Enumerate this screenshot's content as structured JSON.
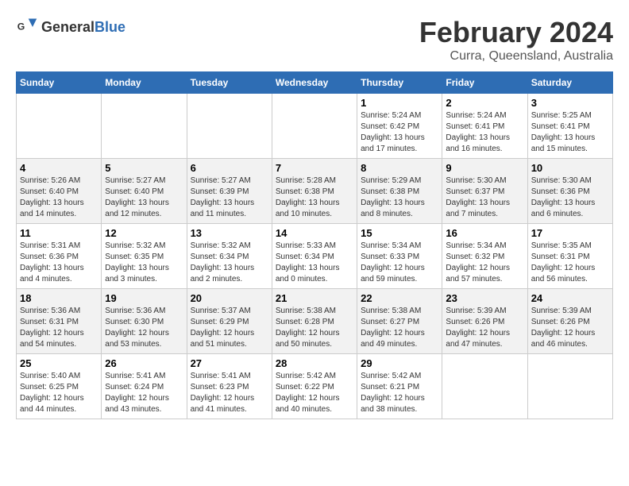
{
  "header": {
    "logo_general": "General",
    "logo_blue": "Blue",
    "title": "February 2024",
    "location": "Curra, Queensland, Australia"
  },
  "days_of_week": [
    "Sunday",
    "Monday",
    "Tuesday",
    "Wednesday",
    "Thursday",
    "Friday",
    "Saturday"
  ],
  "weeks": [
    [
      {
        "day": "",
        "info": ""
      },
      {
        "day": "",
        "info": ""
      },
      {
        "day": "",
        "info": ""
      },
      {
        "day": "",
        "info": ""
      },
      {
        "day": "1",
        "info": "Sunrise: 5:24 AM\nSunset: 6:42 PM\nDaylight: 13 hours\nand 17 minutes."
      },
      {
        "day": "2",
        "info": "Sunrise: 5:24 AM\nSunset: 6:41 PM\nDaylight: 13 hours\nand 16 minutes."
      },
      {
        "day": "3",
        "info": "Sunrise: 5:25 AM\nSunset: 6:41 PM\nDaylight: 13 hours\nand 15 minutes."
      }
    ],
    [
      {
        "day": "4",
        "info": "Sunrise: 5:26 AM\nSunset: 6:40 PM\nDaylight: 13 hours\nand 14 minutes."
      },
      {
        "day": "5",
        "info": "Sunrise: 5:27 AM\nSunset: 6:40 PM\nDaylight: 13 hours\nand 12 minutes."
      },
      {
        "day": "6",
        "info": "Sunrise: 5:27 AM\nSunset: 6:39 PM\nDaylight: 13 hours\nand 11 minutes."
      },
      {
        "day": "7",
        "info": "Sunrise: 5:28 AM\nSunset: 6:38 PM\nDaylight: 13 hours\nand 10 minutes."
      },
      {
        "day": "8",
        "info": "Sunrise: 5:29 AM\nSunset: 6:38 PM\nDaylight: 13 hours\nand 8 minutes."
      },
      {
        "day": "9",
        "info": "Sunrise: 5:30 AM\nSunset: 6:37 PM\nDaylight: 13 hours\nand 7 minutes."
      },
      {
        "day": "10",
        "info": "Sunrise: 5:30 AM\nSunset: 6:36 PM\nDaylight: 13 hours\nand 6 minutes."
      }
    ],
    [
      {
        "day": "11",
        "info": "Sunrise: 5:31 AM\nSunset: 6:36 PM\nDaylight: 13 hours\nand 4 minutes."
      },
      {
        "day": "12",
        "info": "Sunrise: 5:32 AM\nSunset: 6:35 PM\nDaylight: 13 hours\nand 3 minutes."
      },
      {
        "day": "13",
        "info": "Sunrise: 5:32 AM\nSunset: 6:34 PM\nDaylight: 13 hours\nand 2 minutes."
      },
      {
        "day": "14",
        "info": "Sunrise: 5:33 AM\nSunset: 6:34 PM\nDaylight: 13 hours\nand 0 minutes."
      },
      {
        "day": "15",
        "info": "Sunrise: 5:34 AM\nSunset: 6:33 PM\nDaylight: 12 hours\nand 59 minutes."
      },
      {
        "day": "16",
        "info": "Sunrise: 5:34 AM\nSunset: 6:32 PM\nDaylight: 12 hours\nand 57 minutes."
      },
      {
        "day": "17",
        "info": "Sunrise: 5:35 AM\nSunset: 6:31 PM\nDaylight: 12 hours\nand 56 minutes."
      }
    ],
    [
      {
        "day": "18",
        "info": "Sunrise: 5:36 AM\nSunset: 6:31 PM\nDaylight: 12 hours\nand 54 minutes."
      },
      {
        "day": "19",
        "info": "Sunrise: 5:36 AM\nSunset: 6:30 PM\nDaylight: 12 hours\nand 53 minutes."
      },
      {
        "day": "20",
        "info": "Sunrise: 5:37 AM\nSunset: 6:29 PM\nDaylight: 12 hours\nand 51 minutes."
      },
      {
        "day": "21",
        "info": "Sunrise: 5:38 AM\nSunset: 6:28 PM\nDaylight: 12 hours\nand 50 minutes."
      },
      {
        "day": "22",
        "info": "Sunrise: 5:38 AM\nSunset: 6:27 PM\nDaylight: 12 hours\nand 49 minutes."
      },
      {
        "day": "23",
        "info": "Sunrise: 5:39 AM\nSunset: 6:26 PM\nDaylight: 12 hours\nand 47 minutes."
      },
      {
        "day": "24",
        "info": "Sunrise: 5:39 AM\nSunset: 6:26 PM\nDaylight: 12 hours\nand 46 minutes."
      }
    ],
    [
      {
        "day": "25",
        "info": "Sunrise: 5:40 AM\nSunset: 6:25 PM\nDaylight: 12 hours\nand 44 minutes."
      },
      {
        "day": "26",
        "info": "Sunrise: 5:41 AM\nSunset: 6:24 PM\nDaylight: 12 hours\nand 43 minutes."
      },
      {
        "day": "27",
        "info": "Sunrise: 5:41 AM\nSunset: 6:23 PM\nDaylight: 12 hours\nand 41 minutes."
      },
      {
        "day": "28",
        "info": "Sunrise: 5:42 AM\nSunset: 6:22 PM\nDaylight: 12 hours\nand 40 minutes."
      },
      {
        "day": "29",
        "info": "Sunrise: 5:42 AM\nSunset: 6:21 PM\nDaylight: 12 hours\nand 38 minutes."
      },
      {
        "day": "",
        "info": ""
      },
      {
        "day": "",
        "info": ""
      }
    ]
  ]
}
